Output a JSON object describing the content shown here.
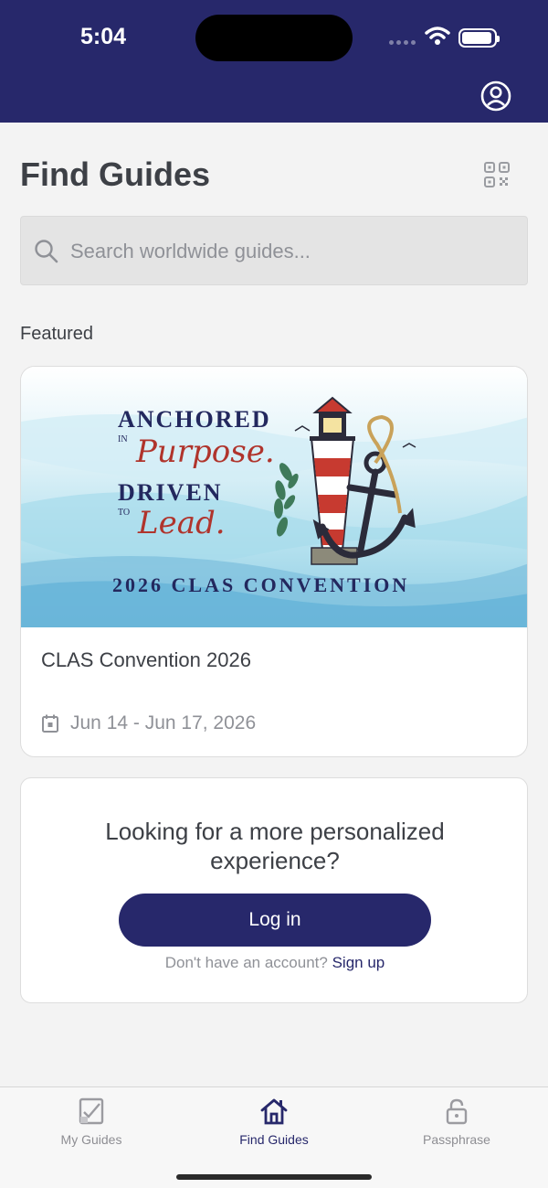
{
  "status_bar": {
    "time": "5:04"
  },
  "header": {
    "account_icon": "account-circle-icon"
  },
  "page": {
    "title": "Find Guides",
    "qr_icon": "qr-code-icon"
  },
  "search": {
    "placeholder": "Search worldwide guides...",
    "value": "",
    "icon": "search-icon"
  },
  "featured": {
    "label": "Featured",
    "guide": {
      "title": "CLAS Convention 2026",
      "date_range": "Jun 14 - Jun 17, 2026",
      "date_icon": "calendar-icon",
      "banner": {
        "line1": "ANCHORED",
        "line1_small": "IN",
        "line2": "Purpose.",
        "line3": "DRIVEN",
        "line3_small": "TO",
        "line4": "Lead.",
        "footer": "2026 CLAS CONVENTION"
      }
    }
  },
  "login_prompt": {
    "heading": "Looking for a more personalized experience?",
    "button": "Log in",
    "no_account": "Don't have an account?",
    "signup": "Sign up"
  },
  "tab_bar": {
    "tabs": [
      {
        "label": "My Guides",
        "icon": "checklist-icon",
        "active": false
      },
      {
        "label": "Find Guides",
        "icon": "home-icon",
        "active": true
      },
      {
        "label": "Passphrase",
        "icon": "lock-icon",
        "active": false
      }
    ]
  },
  "colors": {
    "brand": "#27286b",
    "background": "#f3f3f3",
    "text": "#3d4046",
    "muted": "#8f9197",
    "banner_red": "#b0342c"
  }
}
